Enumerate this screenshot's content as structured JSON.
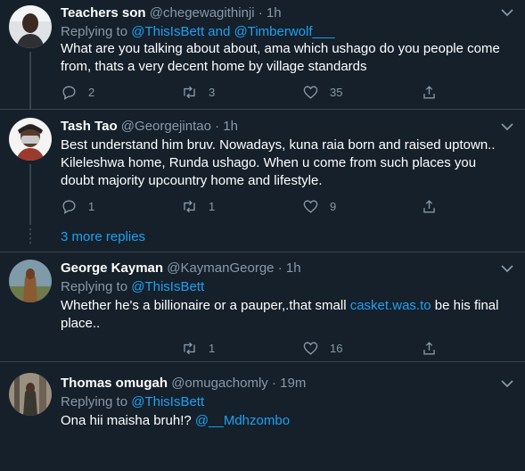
{
  "tweets": [
    {
      "name": "Teachers son",
      "handle": "@chegewagithinji",
      "dot": "·",
      "time": "1h",
      "replying_prefix": "Replying to",
      "replying_targets": "@ThisIsBett and @Timberwolf___",
      "text": "What are you talking about about, ama which ushago do you people come from, thats a very decent home by village standards",
      "replies": "2",
      "retweets": "3",
      "likes": "35"
    },
    {
      "name": "Tash Tao",
      "handle": "@Georgejintao",
      "dot": "·",
      "time": "1h",
      "text": "Best understand him bruv. Nowadays, kuna raia born and raised uptown.. Kileleshwa home,  Runda ushago. When u come from such places you doubt majority upcountry home and lifestyle.",
      "replies": "1",
      "retweets": "1",
      "likes": "9"
    },
    {
      "name": "George Kayman",
      "handle": "@KaymanGeorge",
      "dot": "·",
      "time": "1h",
      "replying_prefix": "Replying to",
      "replying_targets": "@ThisIsBett",
      "text_before": "Whether he's a billionaire or a pauper,.that small ",
      "text_link": "casket.was.to",
      "text_after": " be his final place..",
      "replies": "",
      "retweets": "1",
      "likes": "16"
    },
    {
      "name": "Thomas omugah",
      "handle": "@omugachomly",
      "dot": "·",
      "time": "19m",
      "replying_prefix": "Replying to",
      "replying_targets": "@ThisIsBett",
      "text_before": "Ona hii maisha bruh!? ",
      "text_link": "@__Mdhzombo"
    }
  ],
  "more_replies": "3 more replies",
  "colors": {
    "background": "#15202b",
    "border": "#38444d",
    "secondary_text": "#8899a6",
    "link": "#1da1f2"
  },
  "icons": [
    "reply-icon",
    "retweet-icon",
    "like-icon",
    "share-icon",
    "caret-down-icon"
  ]
}
